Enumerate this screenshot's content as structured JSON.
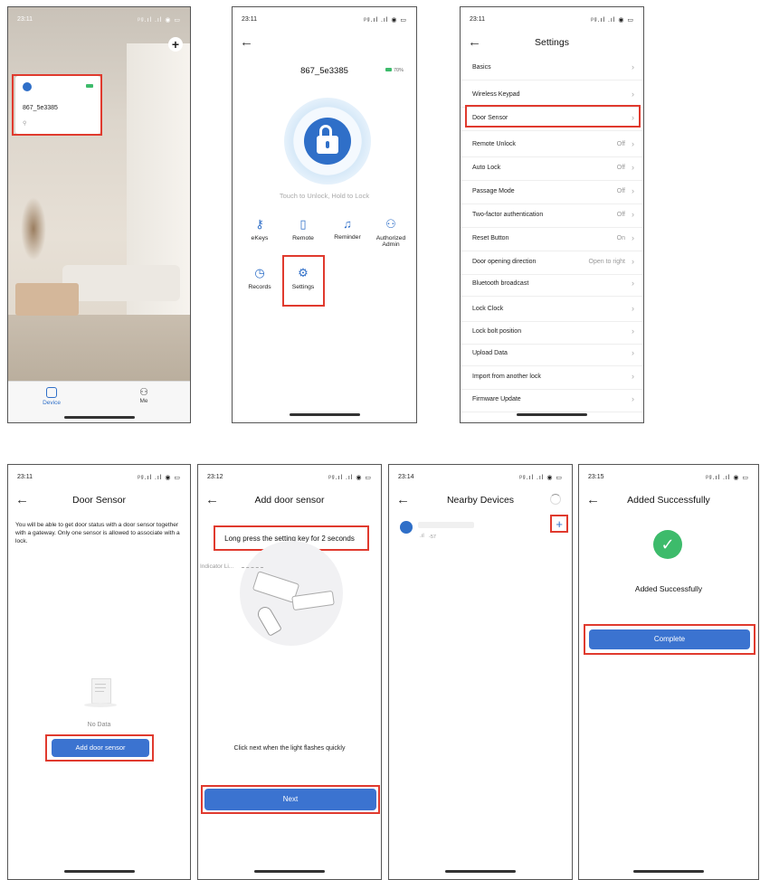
{
  "status_bar": {
    "icons": "ᵖᵍ.ıl .ıl ◉ ▭"
  },
  "screen_home": {
    "time": "23:11",
    "lock_name": "867_5e3385",
    "tabs": [
      {
        "label": "Device"
      },
      {
        "label": "Me"
      }
    ]
  },
  "screen_lock": {
    "time": "23:11",
    "lock_name": "867_5e3385",
    "battery": "70%",
    "hint": "Touch to Unlock, Hold to Lock",
    "menu": [
      {
        "label": "eKeys",
        "icon": "key-icon"
      },
      {
        "label": "Remote",
        "icon": "remote-icon"
      },
      {
        "label": "Reminder",
        "icon": "bell-icon"
      },
      {
        "label": "Authorized Admin",
        "icon": "admin-icon"
      },
      {
        "label": "Records",
        "icon": "history-icon"
      },
      {
        "label": "Settings",
        "icon": "gear-icon"
      }
    ]
  },
  "screen_settings": {
    "time": "23:11",
    "title": "Settings",
    "rows": [
      {
        "label": "Basics",
        "value": ""
      },
      {
        "label": "Wireless Keypad",
        "value": ""
      },
      {
        "label": "Door Sensor",
        "value": ""
      },
      {
        "label": "Remote Unlock",
        "value": "Off"
      },
      {
        "label": "Auto Lock",
        "value": "Off"
      },
      {
        "label": "Passage Mode",
        "value": "Off"
      },
      {
        "label": "Two-factor authentication",
        "value": "Off"
      },
      {
        "label": "Reset Button",
        "value": "On"
      },
      {
        "label": "Door opening direction",
        "value": "Open to right"
      },
      {
        "label": "Bluetooth broadcast",
        "value": ""
      },
      {
        "label": "Lock Clock",
        "value": ""
      },
      {
        "label": "Lock bolt position",
        "value": ""
      },
      {
        "label": "Upload Data",
        "value": ""
      },
      {
        "label": "Import from another lock",
        "value": ""
      },
      {
        "label": "Firmware Update",
        "value": ""
      }
    ]
  },
  "screen_door_sensor": {
    "time": "23:11",
    "title": "Door Sensor",
    "description": "You will be able to get door status with a door sensor together with a gateway. Only one sensor is allowed to associate with a lock.",
    "empty_text": "No Data",
    "button": "Add door sensor"
  },
  "screen_add_sensor": {
    "time": "23:12",
    "title": "Add door sensor",
    "instruction": "Long press the setting key for 2 seconds",
    "indicator_label": "Indicator Li...",
    "hint": "Click next when the light flashes quickly",
    "button": "Next"
  },
  "screen_nearby": {
    "time": "23:14",
    "title": "Nearby Devices",
    "device_signal": "-57"
  },
  "screen_success": {
    "time": "23:15",
    "title": "Added Successfully",
    "message": "Added Successfully",
    "button": "Complete"
  },
  "colors": {
    "accent": "#2f6fc8",
    "highlight": "#e03a2e",
    "success": "#3dbb6b"
  }
}
